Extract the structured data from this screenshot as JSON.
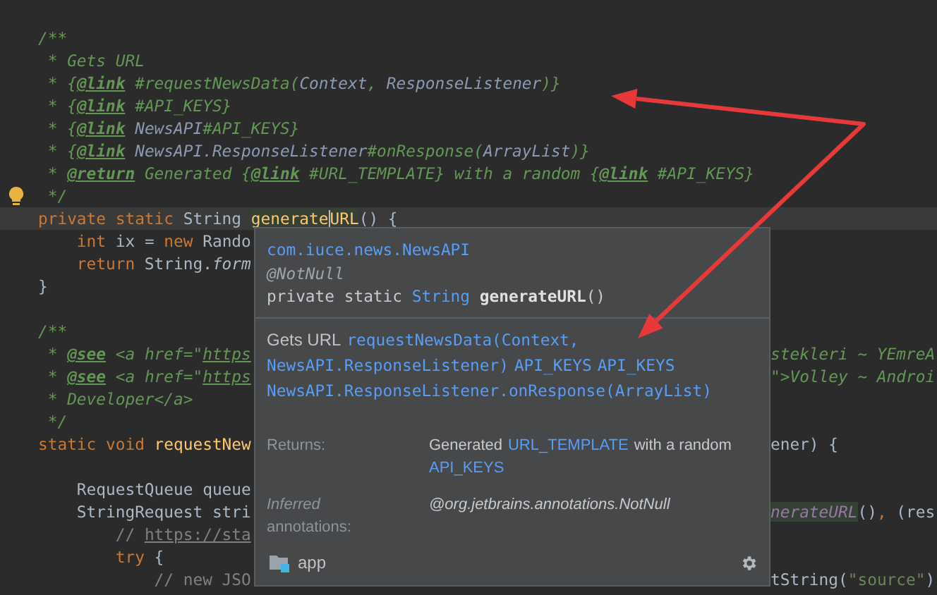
{
  "editor": {
    "lines": [
      {
        "current": false,
        "intention": false,
        "tokens": [
          {
            "text": "/**",
            "kind": "doc"
          }
        ]
      },
      {
        "current": false,
        "intention": false,
        "tokens": [
          {
            "text": " * Gets URL",
            "kind": "doc"
          }
        ]
      },
      {
        "current": false,
        "intention": false,
        "tokens": [
          {
            "text": " * {",
            "kind": "doc"
          },
          {
            "text": "@link",
            "kind": "doctag"
          },
          {
            "text": " #requestNewsData(",
            "kind": "doc"
          },
          {
            "text": "Context",
            "kind": "docref"
          },
          {
            "text": ", ",
            "kind": "doc"
          },
          {
            "text": "ResponseListener",
            "kind": "docref"
          },
          {
            "text": ")}",
            "kind": "doc"
          }
        ]
      },
      {
        "current": false,
        "intention": false,
        "tokens": [
          {
            "text": " * {",
            "kind": "doc"
          },
          {
            "text": "@link",
            "kind": "doctag"
          },
          {
            "text": " #API_KEYS}",
            "kind": "doc"
          }
        ]
      },
      {
        "current": false,
        "intention": false,
        "tokens": [
          {
            "text": " * {",
            "kind": "doc"
          },
          {
            "text": "@link",
            "kind": "doctag"
          },
          {
            "text": " NewsAPI",
            "kind": "docref"
          },
          {
            "text": "#API_KEYS}",
            "kind": "doc"
          }
        ]
      },
      {
        "current": false,
        "intention": false,
        "tokens": [
          {
            "text": " * {",
            "kind": "doc"
          },
          {
            "text": "@link",
            "kind": "doctag"
          },
          {
            "text": " NewsAPI.ResponseListener",
            "kind": "docref"
          },
          {
            "text": "#onResponse(",
            "kind": "doc"
          },
          {
            "text": "ArrayList",
            "kind": "docref"
          },
          {
            "text": ")}",
            "kind": "doc"
          }
        ]
      },
      {
        "current": false,
        "intention": false,
        "tokens": [
          {
            "text": " * ",
            "kind": "doc"
          },
          {
            "text": "@return",
            "kind": "doctag"
          },
          {
            "text": " Generated {",
            "kind": "doc"
          },
          {
            "text": "@link",
            "kind": "doctag"
          },
          {
            "text": " #URL_TEMPLATE} with a random {",
            "kind": "doc"
          },
          {
            "text": "@link",
            "kind": "doctag"
          },
          {
            "text": " #API_KEYS}",
            "kind": "doc"
          }
        ]
      },
      {
        "current": false,
        "intention": true,
        "tokens": [
          {
            "text": " */",
            "kind": "doc"
          }
        ]
      },
      {
        "current": true,
        "intention": false,
        "tokens": [
          {
            "text": "private static ",
            "kind": "kw"
          },
          {
            "text": "String ",
            "kind": "plain"
          },
          {
            "text": "generate",
            "kind": "hl"
          },
          {
            "kind": "caret"
          },
          {
            "text": "URL",
            "kind": "hl"
          },
          {
            "text": "() {",
            "kind": "plain"
          }
        ]
      },
      {
        "current": false,
        "intention": false,
        "tokens": [
          {
            "text": "    int",
            "kind": "kw"
          },
          {
            "text": " ix = ",
            "kind": "plain"
          },
          {
            "text": "new",
            "kind": "kw"
          },
          {
            "text": " Rando",
            "kind": "plain"
          }
        ]
      },
      {
        "current": false,
        "intention": false,
        "tokens": [
          {
            "text": "    return",
            "kind": "kw"
          },
          {
            "text": " String.",
            "kind": "plain"
          },
          {
            "text": "form",
            "kind": "italic"
          }
        ]
      },
      {
        "current": false,
        "intention": false,
        "tokens": [
          {
            "text": "}",
            "kind": "plain"
          }
        ]
      },
      {
        "current": false,
        "intention": false
      },
      {
        "current": false,
        "intention": false,
        "tokens": [
          {
            "text": "/**",
            "kind": "doc"
          }
        ]
      },
      {
        "current": false,
        "intention": false,
        "tokens": [
          {
            "text": " * ",
            "kind": "doc"
          },
          {
            "text": "@see",
            "kind": "doctag"
          },
          {
            "text": " <a href=\"",
            "kind": "doc"
          },
          {
            "text": "https",
            "kind": "doclink"
          }
        ],
        "right": [
          {
            "text": "stekleri ~ YEmreA",
            "kind": "doc"
          }
        ]
      },
      {
        "current": false,
        "intention": false,
        "tokens": [
          {
            "text": " * ",
            "kind": "doc"
          },
          {
            "text": "@see",
            "kind": "doctag"
          },
          {
            "text": " <a href=\"",
            "kind": "doc"
          },
          {
            "text": "https",
            "kind": "doclink"
          }
        ],
        "right": [
          {
            "text": "\">Volley ~ Androi",
            "kind": "doc"
          }
        ]
      },
      {
        "current": false,
        "intention": false,
        "tokens": [
          {
            "text": " * Developer</a>",
            "kind": "doc"
          }
        ]
      },
      {
        "current": false,
        "intention": false,
        "tokens": [
          {
            "text": " */",
            "kind": "doc"
          }
        ]
      },
      {
        "current": false,
        "intention": false,
        "tokens": [
          {
            "text": "static void ",
            "kind": "kw"
          },
          {
            "text": "requestNew",
            "kind": "method"
          }
        ],
        "right": [
          {
            "text": "ener) {",
            "kind": "plain"
          }
        ]
      },
      {
        "current": false,
        "intention": false
      },
      {
        "current": false,
        "intention": false,
        "tokens": [
          {
            "text": "    RequestQueue queue",
            "kind": "plain"
          }
        ]
      },
      {
        "current": false,
        "intention": false,
        "tokens": [
          {
            "text": "    StringRequest stri",
            "kind": "plain"
          }
        ],
        "right": [
          {
            "text": "nerateURL",
            "kind": "hlitalic"
          },
          {
            "text": "()",
            "kind": "plain"
          },
          {
            "text": ", ",
            "kind": "kw"
          },
          {
            "text": "(res",
            "kind": "plain"
          }
        ]
      },
      {
        "current": false,
        "intention": false,
        "tokens": [
          {
            "text": "        // ",
            "kind": "comment"
          },
          {
            "text": "https://sta",
            "kind": "url"
          }
        ]
      },
      {
        "current": false,
        "intention": false,
        "tokens": [
          {
            "text": "        try",
            "kind": "kw"
          },
          {
            "text": " {",
            "kind": "plain"
          }
        ]
      },
      {
        "current": false,
        "intention": false,
        "tokens": [
          {
            "text": "            // new JSO",
            "kind": "comment"
          }
        ],
        "right": [
          {
            "text": "tString(",
            "kind": "plain"
          },
          {
            "text": "\"source\"",
            "kind": "string"
          },
          {
            "text": ")",
            "kind": "plain"
          }
        ]
      }
    ]
  },
  "popup": {
    "package": "com.iuce.news.NewsAPI",
    "annotation": "@NotNull",
    "signature": [
      {
        "text": "private static ",
        "kind": "plain"
      },
      {
        "text": "String ",
        "kind": "type"
      },
      {
        "text": "generateURL",
        "kind": "name"
      },
      {
        "text": "()",
        "kind": "plain"
      }
    ],
    "description_lines": [
      [
        {
          "text": "Gets URL",
          "kind": "text"
        },
        {
          "text": "requestNewsData(Context,",
          "kind": "link"
        }
      ],
      [
        {
          "text": "NewsAPI.ResponseListener)",
          "kind": "link"
        },
        {
          "text": "API_KEYS",
          "kind": "link"
        },
        {
          "text": "API_KEYS",
          "kind": "link"
        }
      ],
      [
        {
          "text": "NewsAPI.ResponseListener.onResponse(ArrayList)",
          "kind": "link"
        }
      ]
    ],
    "sections": [
      {
        "label": [
          {
            "text": "Returns:",
            "kind": "text"
          }
        ],
        "value": [
          {
            "text": "Generated",
            "kind": "text"
          },
          {
            "text": "URL_TEMPLATE",
            "kind": "link"
          },
          {
            "text": "with a random",
            "kind": "text"
          },
          {
            "text": "API_KEYS",
            "kind": "link"
          }
        ]
      },
      {
        "label": [
          {
            "text": "Inferred",
            "kind": "italic"
          },
          {
            "text": "annotations:",
            "kind": "text"
          }
        ],
        "value": [
          {
            "text": "@org.jetbrains.annotations.NotNull",
            "kind": "italic"
          }
        ]
      }
    ],
    "module": "app"
  }
}
